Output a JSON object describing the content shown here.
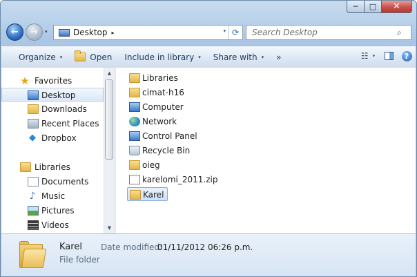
{
  "window": {
    "caption": {
      "minimize": "─",
      "maximize": "□",
      "close": "✕"
    }
  },
  "nav": {
    "back_glyph": "←",
    "forward_glyph": "→",
    "dropdown_glyph": "▾",
    "address": {
      "location": "Desktop",
      "separator": "▸",
      "dropdown_glyph": "▾",
      "refresh_glyph": "⟳"
    },
    "search": {
      "placeholder": "Search Desktop",
      "icon_glyph": "⌕"
    }
  },
  "toolbar": {
    "organize": "Organize",
    "open": "Open",
    "include_in_library": "Include in library",
    "share_with": "Share with",
    "more": "»",
    "dropdown_glyph": "▾",
    "views_glyph": "☷",
    "help_glyph": "?"
  },
  "sidebar": {
    "favorites_header": "Favorites",
    "favorites": [
      {
        "label": "Desktop",
        "icon": "desktop-icon"
      },
      {
        "label": "Downloads",
        "icon": "downloads-folder-icon"
      },
      {
        "label": "Recent Places",
        "icon": "recent-places-icon"
      },
      {
        "label": "Dropbox",
        "icon": "dropbox-icon"
      }
    ],
    "libraries_header": "Libraries",
    "libraries": [
      {
        "label": "Documents",
        "icon": "documents-icon"
      },
      {
        "label": "Music",
        "icon": "music-icon"
      },
      {
        "label": "Pictures",
        "icon": "pictures-icon"
      },
      {
        "label": "Videos",
        "icon": "videos-icon"
      }
    ],
    "scroll_up_glyph": "▲",
    "scroll_down_glyph": "▼"
  },
  "files": [
    {
      "label": "Libraries",
      "icon": "libraries-icon"
    },
    {
      "label": "cimat-h16",
      "icon": "user-folder-icon"
    },
    {
      "label": "Computer",
      "icon": "computer-icon"
    },
    {
      "label": "Network",
      "icon": "network-icon"
    },
    {
      "label": "Control Panel",
      "icon": "control-panel-icon"
    },
    {
      "label": "Recycle Bin",
      "icon": "recycle-bin-icon"
    },
    {
      "label": "oieg",
      "icon": "folder-icon"
    },
    {
      "label": "karelomi_2011.zip",
      "icon": "zip-file-icon"
    },
    {
      "label": "Karel",
      "icon": "folder-icon",
      "selected": true
    }
  ],
  "details": {
    "name": "Karel",
    "type": "File folder",
    "modified_label": "Date modified:",
    "modified_value": "01/11/2012 06:26 p.m."
  },
  "colors": {
    "window_frame": "#b9d1ea",
    "selection_border": "#84acdd",
    "selection_fill": "#cfe2f8",
    "close_button": "#c75050"
  }
}
